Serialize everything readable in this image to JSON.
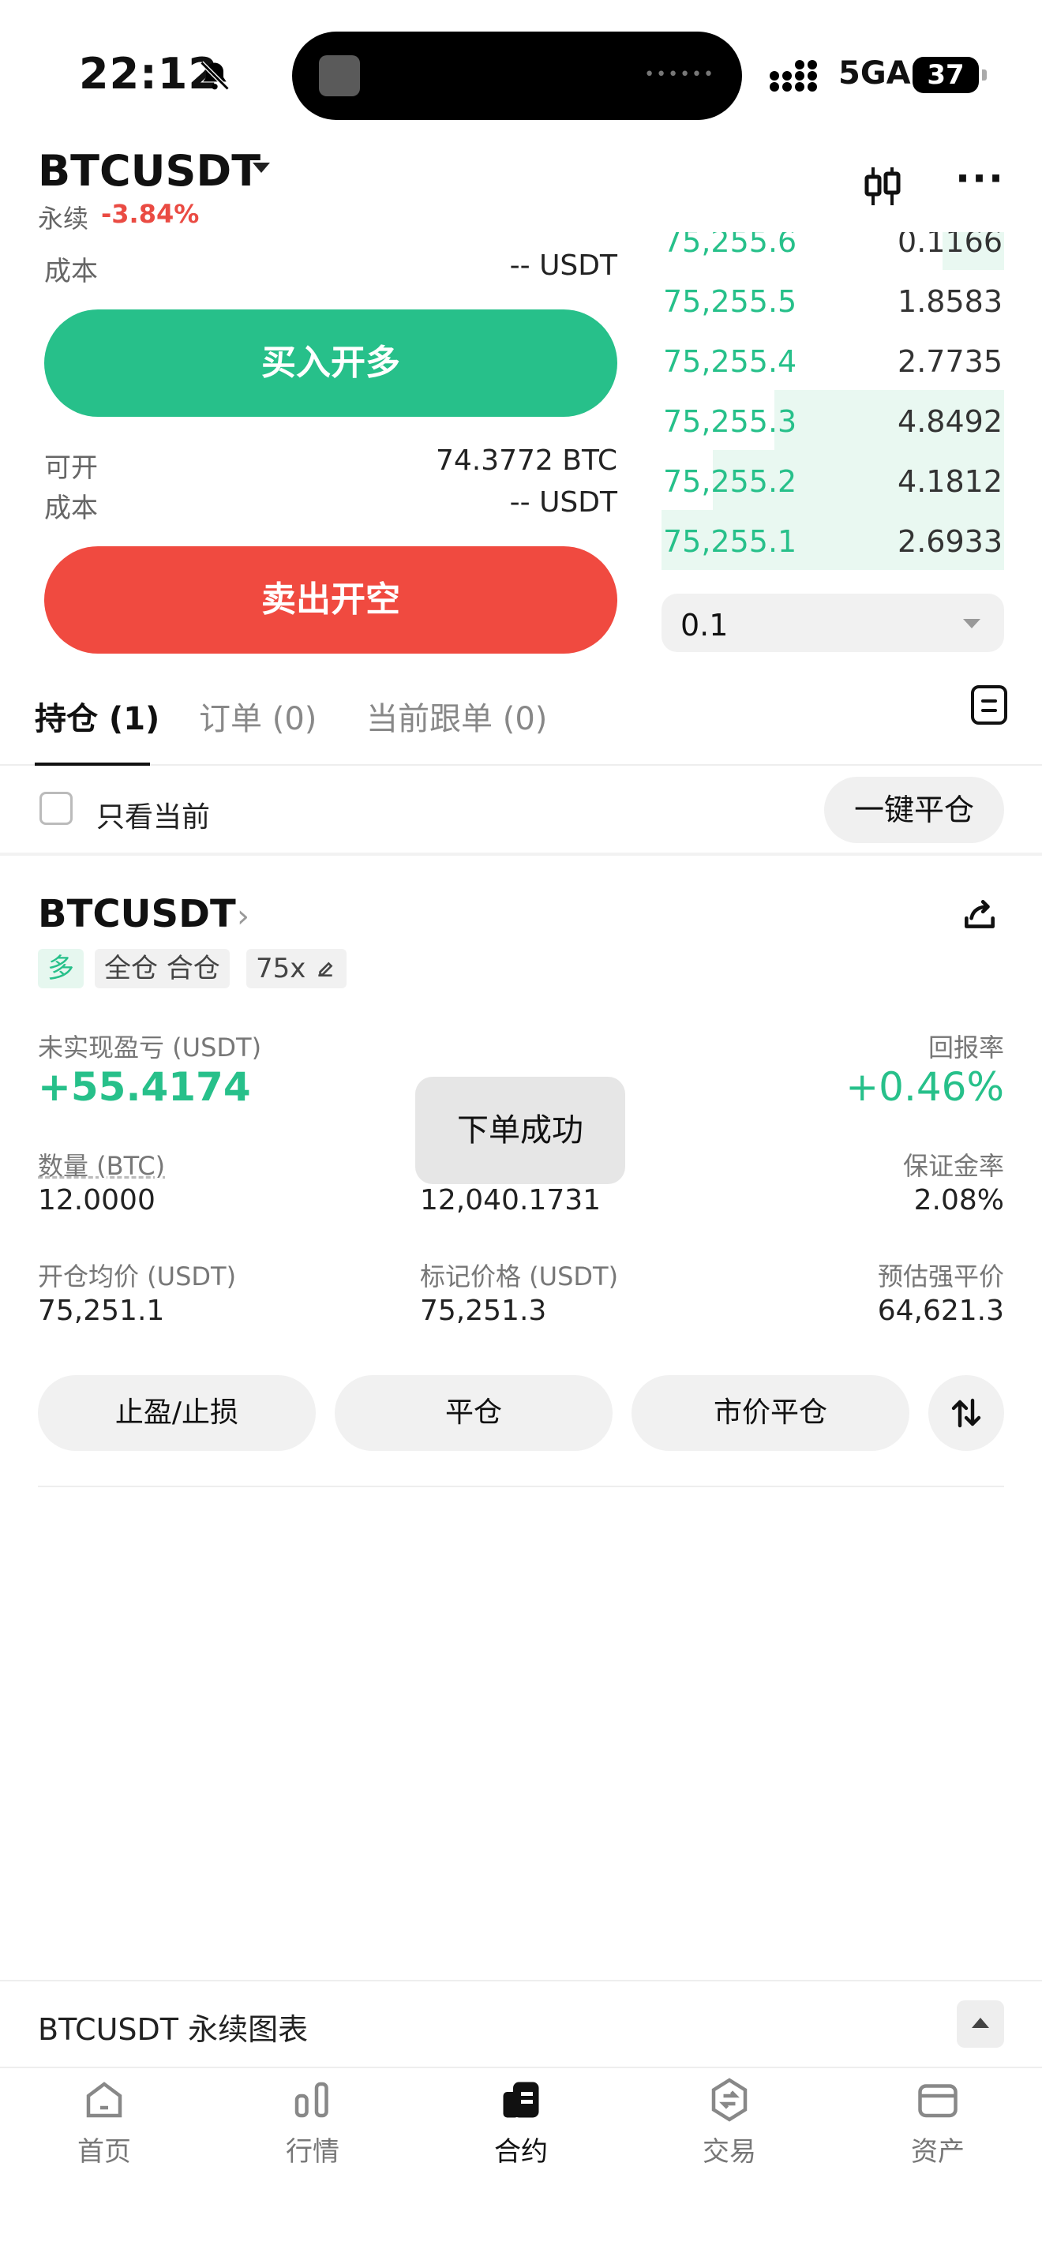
{
  "status_bar": {
    "time": "22:12",
    "network": "5GA",
    "battery": "37"
  },
  "header": {
    "symbol": "BTCUSDT",
    "contract_type": "永续",
    "change": "-3.84%"
  },
  "order_form": {
    "cost_label_top": "成本",
    "cost_value_top": "-- USDT",
    "buy_button": "买入开多",
    "available_label": "可开",
    "available_value": "74.3772 BTC",
    "cost_label": "成本",
    "cost_value": "-- USDT",
    "sell_button": "卖出开空"
  },
  "order_book": {
    "bids": [
      {
        "price": "75,255.6",
        "qty": "0.1166",
        "depth": 0.18
      },
      {
        "price": "75,255.5",
        "qty": "1.8583",
        "depth": 0.0
      },
      {
        "price": "75,255.4",
        "qty": "2.7735",
        "depth": 0.0
      },
      {
        "price": "75,255.3",
        "qty": "4.8492",
        "depth": 0.67
      },
      {
        "price": "75,255.2",
        "qty": "4.1812",
        "depth": 0.85
      },
      {
        "price": "75,255.1",
        "qty": "2.6933",
        "depth": 1.0
      }
    ],
    "depth_step": "0.1"
  },
  "tabs": [
    {
      "label": "持仓 (1)",
      "active": true
    },
    {
      "label": "订单 (0)",
      "active": false
    },
    {
      "label": "当前跟单 (0)",
      "active": false
    }
  ],
  "filter": {
    "only_current": "只看当前",
    "close_all": "一键平仓"
  },
  "position": {
    "symbol": "BTCUSDT",
    "tags": [
      "多",
      "全仓 合仓",
      "75x"
    ],
    "unrealized_label": "未实现盈亏 (USDT)",
    "unrealized_value": "+55.4174",
    "roe_label": "回报率",
    "roe_value": "+0.46%",
    "qty_label": "数量 (BTC)",
    "qty_value": "12.0000",
    "margin_value": "12,040.1731",
    "margin_rate_label": "保证金率",
    "margin_rate_value": "2.08%",
    "entry_label": "开仓均价 (USDT)",
    "entry_value": "75,251.1",
    "mark_label": "标记价格 (USDT)",
    "mark_value": "75,251.3",
    "liq_label": "预估强平价",
    "liq_value": "64,621.3",
    "toast": "下单成功"
  },
  "actions": {
    "tp_sl": "止盈/止损",
    "close": "平仓",
    "market_close": "市价平仓"
  },
  "chart_bar": {
    "label": "BTCUSDT 永续图表"
  },
  "bottom_nav": [
    {
      "label": "首页",
      "icon": "home-icon"
    },
    {
      "label": "行情",
      "icon": "market-icon"
    },
    {
      "label": "合约",
      "icon": "futures-icon"
    },
    {
      "label": "交易",
      "icon": "trade-icon"
    },
    {
      "label": "资产",
      "icon": "wallet-icon"
    }
  ],
  "colors": {
    "buy": "#27c08a",
    "sell": "#f04a40",
    "bid_depth_bg": "#e9f8f1"
  }
}
